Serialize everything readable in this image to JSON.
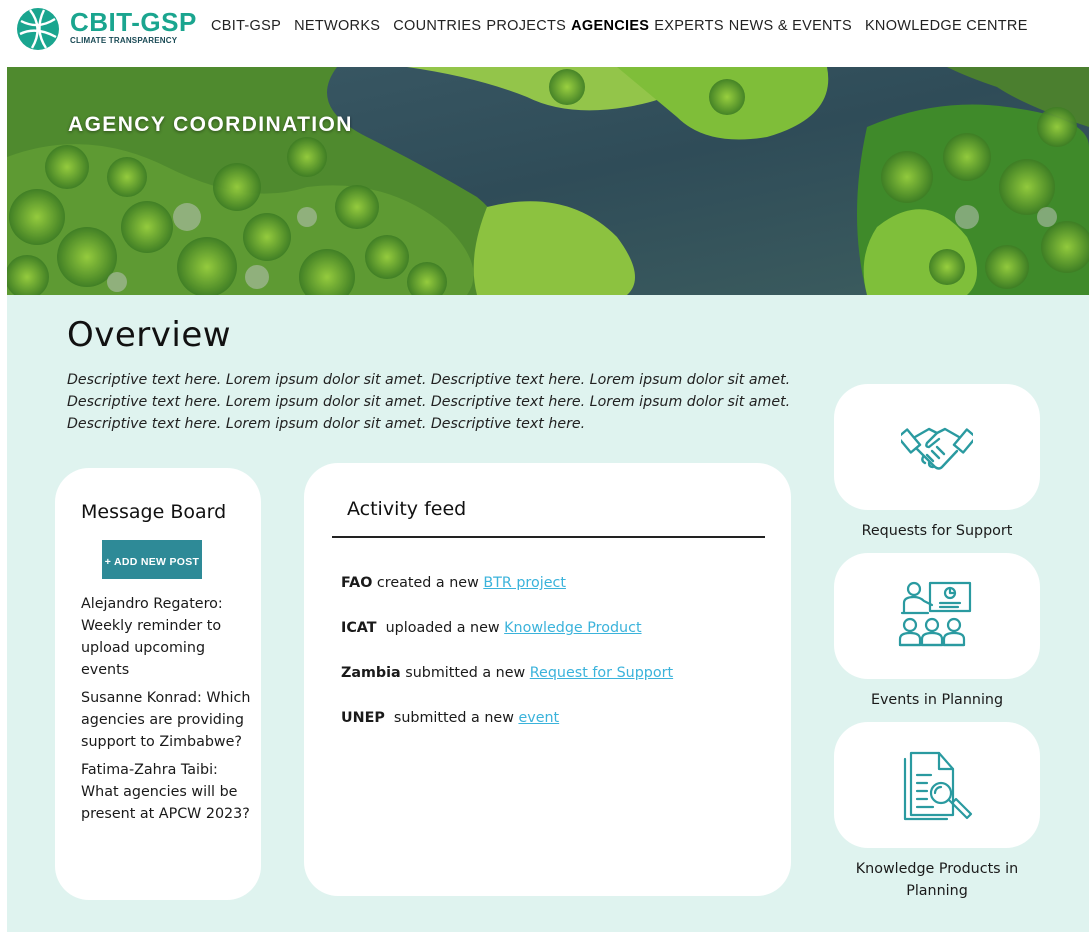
{
  "brand": {
    "name": "CBIT-GSP",
    "tagline": "CLIMATE TRANSPARENCY",
    "color": "#1aa58f"
  },
  "nav": {
    "items": [
      {
        "label": "CBIT-GSP",
        "active": false
      },
      {
        "label": "NETWORKS",
        "active": false
      },
      {
        "label": "COUNTRIES",
        "active": false
      },
      {
        "label": "PROJECTS",
        "active": false
      },
      {
        "label": "AGENCIES",
        "active": true
      },
      {
        "label": "EXPERTS",
        "active": false
      },
      {
        "label": "NEWS & EVENTS",
        "active": false
      },
      {
        "label": "KNOWLEDGE CENTRE",
        "active": false
      }
    ]
  },
  "hero": {
    "title": "AGENCY COORDINATION"
  },
  "overview": {
    "title": "Overview",
    "description": "Descriptive text here. Lorem ipsum dolor sit amet. Descriptive text here. Lorem ipsum dolor sit amet. Descriptive text here. Lorem ipsum dolor sit amet. Descriptive text here. Lorem ipsum dolor sit amet. Descriptive text here. Lorem ipsum dolor sit amet. Descriptive text here."
  },
  "message_board": {
    "title": "Message Board",
    "add_button_label": "+ ADD NEW POST",
    "posts": [
      {
        "text": "Alejandro Regatero: Weekly reminder to upload upcoming events"
      },
      {
        "text": "Susanne Konrad: Which agencies are providing support to Zimbabwe?"
      },
      {
        "text": "Fatima-Zahra Taibi: What agencies will be present at APCW 2023?"
      }
    ]
  },
  "activity_feed": {
    "title": "Activity feed",
    "items": [
      {
        "actor": "FAO",
        "action": " created a new ",
        "link": "BTR project"
      },
      {
        "actor": "ICAT",
        "action": "  uploaded a new ",
        "link": "Knowledge Product"
      },
      {
        "actor": "Zambia",
        "action": " submitted a new ",
        "link": "Request for Support"
      },
      {
        "actor": "UNEP",
        "action": "  submitted a new ",
        "link": "event"
      }
    ]
  },
  "side_cards": [
    {
      "icon": "handshake-icon",
      "label": "Requests for Support"
    },
    {
      "icon": "presentation-meeting-icon",
      "label": "Events in Planning"
    },
    {
      "icon": "document-search-icon",
      "label": "Knowledge Products in Planning"
    }
  ],
  "colors": {
    "accent": "#2e8a97",
    "icon": "#2a9aa0",
    "background": "#dff3ef",
    "link": "#3bb3db"
  }
}
